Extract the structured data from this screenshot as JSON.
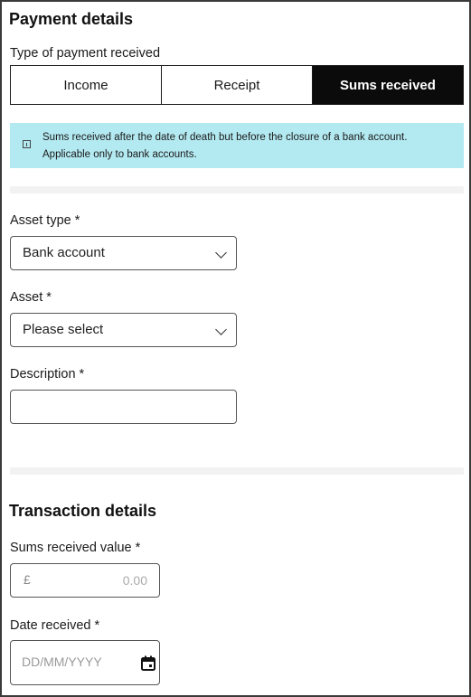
{
  "payment": {
    "title": "Payment details",
    "type_label": "Type of payment received",
    "options": [
      "Income",
      "Receipt",
      "Sums received"
    ],
    "selected": "Sums received",
    "info_line1": "Sums received after the date of death but before the closure of a bank account.",
    "info_line2": "Applicable only to bank accounts."
  },
  "asset_type": {
    "label": "Asset type *",
    "value": "Bank account"
  },
  "asset": {
    "label": "Asset *",
    "value": "Please select"
  },
  "description": {
    "label": "Description *",
    "value": ""
  },
  "transaction": {
    "title": "Transaction details",
    "value_label": "Sums received value *",
    "currency": "£",
    "value_placeholder": "0.00",
    "date_label": "Date received *",
    "date_placeholder": "DD/MM/YYYY"
  },
  "colors": {
    "info_bg": "#b3e9f1",
    "active_bg": "#0b0b0b",
    "divider": "#f2f2f2"
  }
}
